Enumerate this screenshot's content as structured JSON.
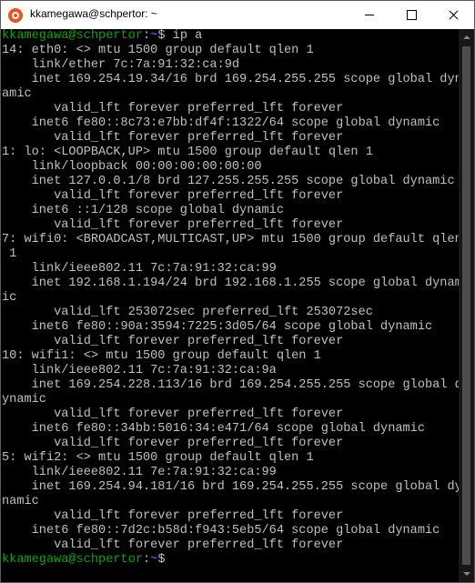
{
  "window": {
    "title": "kkamegawa@schpertor: ~",
    "controls": {
      "minimize": "minimize",
      "maximize": "maximize",
      "close": "close"
    }
  },
  "colors": {
    "prompt_user": "#13a10e",
    "prompt_path": "#3b78ff",
    "text": "#c0c0c0",
    "background": "#000000"
  },
  "terminal": {
    "prompt_top": {
      "user_host": "kkamegawa@schpertor",
      "path": "~",
      "command": " ip a"
    },
    "lines": [
      "14: eth0: <> mtu 1500 group default qlen 1",
      "    link/ether 7c:7a:91:32:ca:9d",
      "    inet 169.254.19.34/16 brd 169.254.255.255 scope global dyn",
      "amic",
      "       valid_lft forever preferred_lft forever",
      "    inet6 fe80::8c73:e7bb:df4f:1322/64 scope global dynamic",
      "       valid_lft forever preferred_lft forever",
      "1: lo: <LOOPBACK,UP> mtu 1500 group default qlen 1",
      "    link/loopback 00:00:00:00:00:00",
      "    inet 127.0.0.1/8 brd 127.255.255.255 scope global dynamic",
      "       valid_lft forever preferred_lft forever",
      "    inet6 ::1/128 scope global dynamic",
      "       valid_lft forever preferred_lft forever",
      "7: wifi0: <BROADCAST,MULTICAST,UP> mtu 1500 group default qlen",
      " 1",
      "    link/ieee802.11 7c:7a:91:32:ca:99",
      "    inet 192.168.1.194/24 brd 192.168.1.255 scope global dynam",
      "ic",
      "       valid_lft 253072sec preferred_lft 253072sec",
      "    inet6 fe80::90a:3594:7225:3d05/64 scope global dynamic",
      "       valid_lft forever preferred_lft forever",
      "10: wifi1: <> mtu 1500 group default qlen 1",
      "    link/ieee802.11 7c:7a:91:32:ca:9a",
      "    inet 169.254.228.113/16 brd 169.254.255.255 scope global d",
      "ynamic",
      "       valid_lft forever preferred_lft forever",
      "    inet6 fe80::34bb:5016:34:e471/64 scope global dynamic",
      "       valid_lft forever preferred_lft forever",
      "5: wifi2: <> mtu 1500 group default qlen 1",
      "    link/ieee802.11 7e:7a:91:32:ca:99",
      "    inet 169.254.94.181/16 brd 169.254.255.255 scope global dy",
      "namic",
      "       valid_lft forever preferred_lft forever",
      "    inet6 fe80::7d2c:b58d:f943:5eb5/64 scope global dynamic",
      "       valid_lft forever preferred_lft forever"
    ],
    "prompt_bottom": {
      "user_host": "kkamegawa@schpertor",
      "path": "~",
      "command": " "
    }
  }
}
